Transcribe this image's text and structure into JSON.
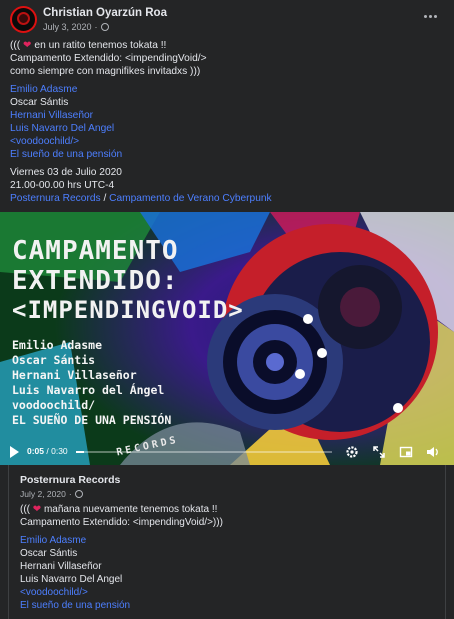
{
  "post": {
    "author": "Christian Oyarzún Roa",
    "date": "July 3, 2020",
    "visibility_sep": "·",
    "line1_pre": "(((",
    "line1_post": "en un ratito tenemos tokata !!",
    "line2": "Campamento Extendido: <impendingVoid/>",
    "line3": "como siempre con magnifikes invitadxs )))",
    "artists": [
      "Emilio Adasme",
      "Oscar Sántis",
      "Hernani Villaseñor",
      "Luis Navarro Del Angel",
      "<voodoochild/>",
      "El sueño de una pensión"
    ],
    "artist_links": [
      true,
      false,
      true,
      true,
      true,
      true
    ],
    "date_line": "Viernes 03 de Julio 2020",
    "time_line": "21.00-00.00 hrs UTC-4",
    "page_link1": "Posternura Records",
    "separator": " / ",
    "page_link2": "Campamento de Verano Cyberpunk"
  },
  "video": {
    "poster_title": [
      "CAMPAMENTO",
      "EXTENDIDO:",
      "<IMPENDINGVOID>"
    ],
    "poster_names": [
      "Emilio Adasme",
      "Oscar Sántis",
      "Hernani Villaseñor",
      "Luis Navarro del Ángel",
      "voodoochild/",
      "EL SUEÑO DE UNA PENSIÓN"
    ],
    "poster_stamp": "RECORDS",
    "current_time": "0:05",
    "time_sep": " / ",
    "duration": "0:30",
    "progress": 0.03
  },
  "shared": {
    "author": "Posternura Records",
    "date": "July 2, 2020",
    "visibility_sep": "·",
    "line1_pre": "(((",
    "line1_post": "mañana nuevamente tenemos tokata !!",
    "line2": "Campamento Extendido: <impendingVoid/>)))",
    "artists": [
      "Emilio Adasme",
      "Oscar Sántis",
      "Hernani Villaseñor",
      "Luis Navarro Del Angel",
      "<voodoochild/>",
      "El sueño de una pensión"
    ],
    "artist_links": [
      true,
      false,
      false,
      false,
      true,
      true
    ]
  },
  "colors": {
    "link": "#4d7fff",
    "heart": "#e0245e",
    "background": "#242526"
  },
  "icons": [
    "more-options-icon",
    "globe-icon",
    "heart-icon",
    "play-icon",
    "settings-icon",
    "fullscreen-icon",
    "picture-in-picture-icon",
    "volume-icon"
  ]
}
